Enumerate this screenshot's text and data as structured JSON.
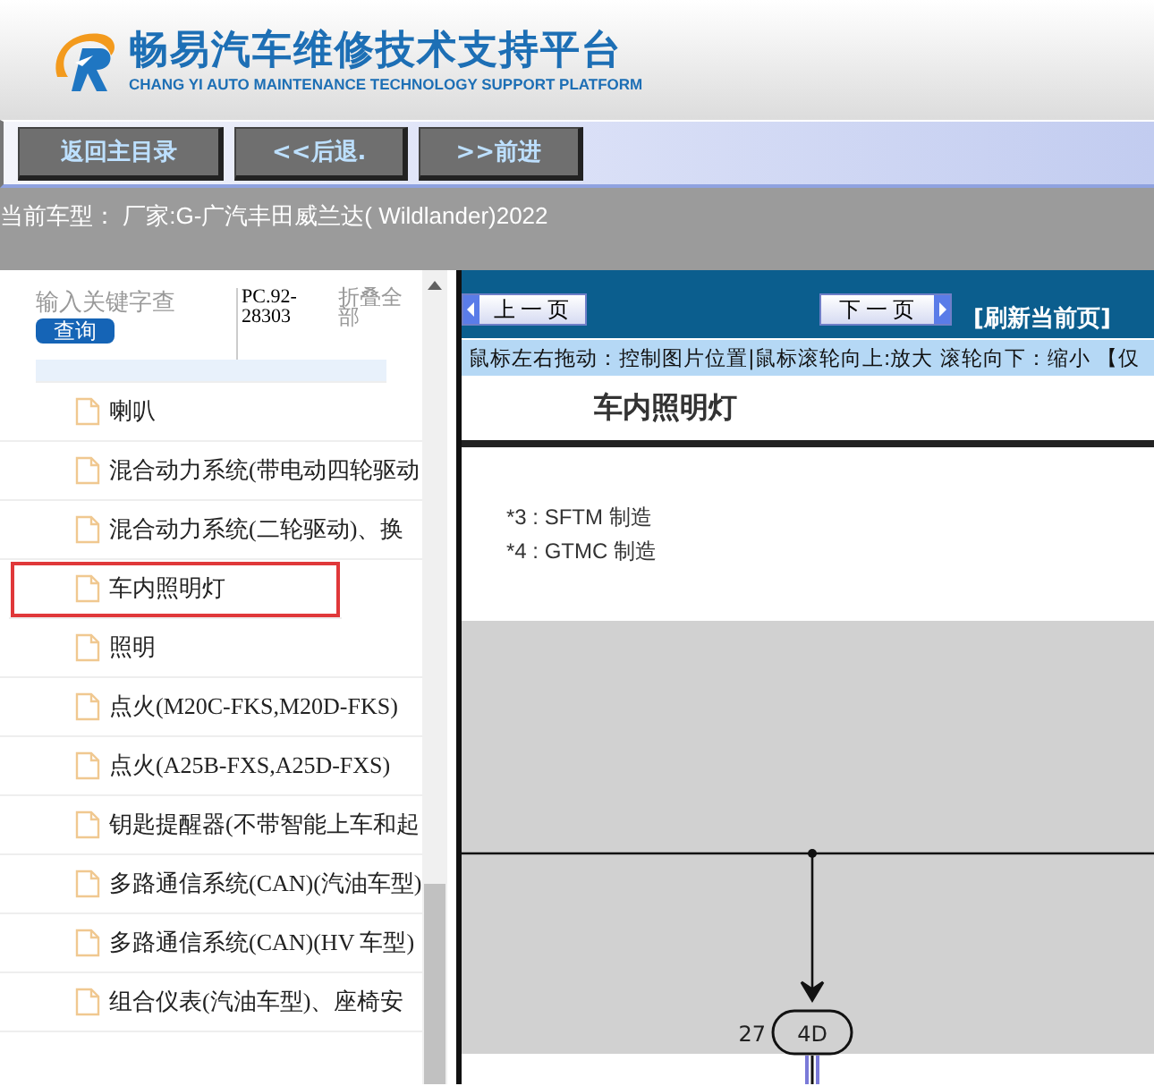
{
  "header": {
    "title": "畅易汽车维修技术支持平台",
    "subtitle": "CHANG YI AUTO MAINTENANCE TECHNOLOGY SUPPORT PLATFORM"
  },
  "toolbar": {
    "buttons": [
      "返回主目录",
      "<<后退.",
      ">>前进"
    ]
  },
  "current_model": "当前车型： 厂家:G-广汽丰田威兰达( Wildlander)2022",
  "sidebar": {
    "search": {
      "placeholder": "输入关键字查",
      "button": "查询"
    },
    "code": "PC.92-28303",
    "collapse": "折叠全部",
    "items": [
      {
        "label": "喇叭",
        "selected": false
      },
      {
        "label": "混合动力系统(带电动四轮驱动",
        "selected": false
      },
      {
        "label": "混合动力系统(二轮驱动)、换",
        "selected": false
      },
      {
        "label": "车内照明灯",
        "selected": true
      },
      {
        "label": "照明",
        "selected": false
      },
      {
        "label": "点火(M20C-FKS,M20D-FKS)",
        "selected": false
      },
      {
        "label": "点火(A25B-FXS,A25D-FXS)",
        "selected": false
      },
      {
        "label": "钥匙提醒器(不带智能上车和起",
        "selected": false
      },
      {
        "label": "多路通信系统(CAN)(汽油车型)",
        "selected": false
      },
      {
        "label": "多路通信系统(CAN)(HV 车型)",
        "selected": false
      },
      {
        "label": "组合仪表(汽油车型)、座椅安",
        "selected": false
      }
    ]
  },
  "viewer": {
    "prev": "上一页",
    "next": "下一页",
    "refresh": "[刷新当前页]",
    "hint": "鼠标左右拖动：控制图片位置|鼠标滚轮向上:放大  滚轮向下：缩小 【仅",
    "page_title": "车内照明灯",
    "notes": [
      "*3 : SFTM 制造",
      "*4 : GTMC 制造"
    ],
    "diagram": {
      "pin": "27",
      "connector": "4D"
    }
  }
}
